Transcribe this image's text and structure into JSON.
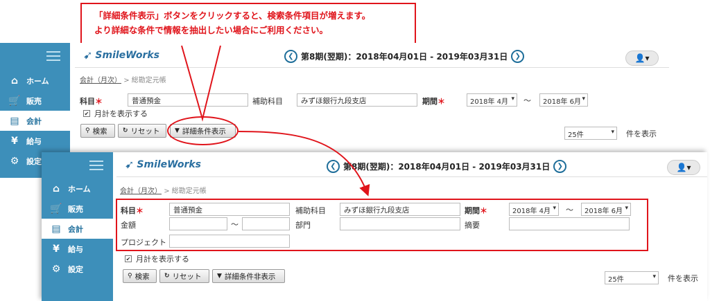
{
  "callout": {
    "line1": "「詳細条件表示」ボタンをクリックすると、検索条件項目が増えます。",
    "line2": "より詳細な条件で情報を抽出したい場合にご利用ください。"
  },
  "app": {
    "logo": "SmileWorks",
    "period": "第8期(翌期)：2018年04月01日 - 2019年03月31日",
    "nav": [
      {
        "label": "ホーム",
        "icon": "⌂"
      },
      {
        "label": "販売",
        "icon": "🛒"
      },
      {
        "label": "会計",
        "icon": "▤"
      },
      {
        "label": "給与",
        "icon": "¥"
      },
      {
        "label": "設定",
        "icon": "⚙"
      }
    ],
    "breadcrumb": {
      "parent": "会計（月次）",
      "sep": ">",
      "current": "総勘定元帳"
    }
  },
  "form": {
    "subject_label": "科目",
    "subject_value": "普通預金",
    "sub_subject_label": "補助科目",
    "sub_subject_value": "みずほ銀行九段支店",
    "period_label": "期間",
    "period_from": "2018年 4月",
    "period_sep": "～",
    "period_to": "2018年 6月",
    "amount_label": "金額",
    "amount_sep": "～",
    "dept_label": "部門",
    "summary_label": "摘要",
    "project_label": "プロジェクト",
    "monthly_label": "月計を表示する",
    "search_btn": "検索",
    "reset_btn": "リセット",
    "detail_show_btn": "詳細条件表示",
    "detail_hide_btn": "詳細条件非表示",
    "per_page_value": "25件",
    "per_page_suffix": "件を表示"
  },
  "colors": {
    "sidebar": "#3d8fba",
    "accent_red": "#e0141b",
    "brand": "#2a6fa0"
  }
}
